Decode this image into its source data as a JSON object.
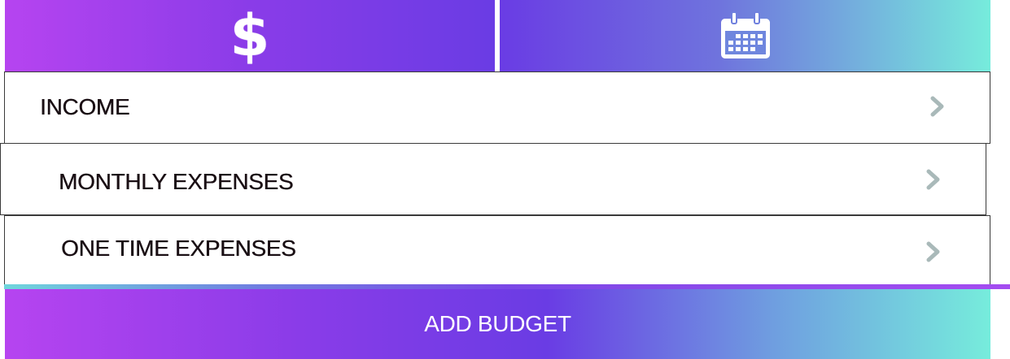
{
  "tabs": [
    {
      "icon": "dollar-icon",
      "glyph": "$"
    },
    {
      "icon": "calendar-icon"
    }
  ],
  "menu": {
    "items": [
      {
        "label": "INCOME"
      },
      {
        "label": "MONTHLY EXPENSES"
      },
      {
        "label": "ONE TIME EXPENSES"
      }
    ]
  },
  "actions": {
    "add_budget_label": "ADD BUDGET"
  },
  "colors": {
    "gradient_purple": "#b644f0",
    "gradient_violet": "#6a3ce4",
    "gradient_teal": "#76ecdc",
    "chevron": "#a9b9b9",
    "text": "#1a0f14"
  }
}
